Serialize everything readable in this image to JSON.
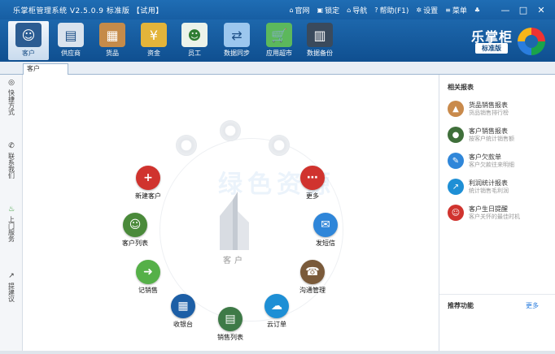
{
  "titlebar": {
    "app_title": "乐掌柜管理系统 V2.5.0.9 标准版 【试用】",
    "links": [
      {
        "icon": "home-icon",
        "glyph": "⌂",
        "label": "官网"
      },
      {
        "icon": "lock-icon",
        "glyph": "▣",
        "label": "锁定"
      },
      {
        "icon": "home-icon",
        "glyph": "⌂",
        "label": "导航"
      },
      {
        "icon": "help-icon",
        "glyph": "?",
        "label": "帮助(F1)"
      },
      {
        "icon": "gear-icon",
        "glyph": "✲",
        "label": "设置"
      },
      {
        "icon": "menu-icon",
        "glyph": "≡",
        "label": "菜单"
      },
      {
        "icon": "shirt-icon",
        "glyph": "♣",
        "label": ""
      }
    ],
    "window_buttons": [
      "—",
      "□",
      "✕"
    ]
  },
  "toolbar": {
    "items": [
      {
        "name": "toolbar-customers",
        "label": "客户",
        "icon": "customer-icon",
        "glyph": "☺",
        "active": true
      },
      {
        "name": "toolbar-suppliers",
        "label": "供应商",
        "icon": "supplier-icon",
        "glyph": "▤",
        "active": false
      },
      {
        "name": "toolbar-goods",
        "label": "货品",
        "icon": "goods-icon",
        "glyph": "▦",
        "active": false
      },
      {
        "name": "toolbar-funds",
        "label": "资金",
        "icon": "money-bag-icon",
        "glyph": "¥",
        "active": false
      },
      {
        "name": "toolbar-employees",
        "label": "员工",
        "icon": "employee-icon",
        "glyph": "☻",
        "active": false
      },
      {
        "name": "toolbar-data-sync",
        "label": "数据同步",
        "icon": "sync-icon",
        "glyph": "⇄",
        "active": false
      },
      {
        "name": "toolbar-app-market",
        "label": "应用超市",
        "icon": "cart-icon",
        "glyph": "🛒",
        "active": false
      },
      {
        "name": "toolbar-data-backup",
        "label": "数据备份",
        "icon": "backup-icon",
        "glyph": "▥",
        "active": false
      }
    ],
    "brand_name": "乐掌柜",
    "brand_edition": "标准版"
  },
  "tabs": [
    {
      "label": "客户"
    }
  ],
  "leftbar": [
    {
      "icon": "refresh-icon",
      "glyph": "◎",
      "label": "快捷方式"
    },
    {
      "icon": "phone-icon",
      "glyph": "✆",
      "label": "联系我们"
    },
    {
      "icon": "bike-icon",
      "glyph": "♨",
      "label": "上门服务"
    },
    {
      "icon": "trend-icon",
      "glyph": "↗",
      "label": "提建议"
    }
  ],
  "center": {
    "label": "客户",
    "watermark": "绿色资源"
  },
  "nodes": [
    {
      "key": "new_customer",
      "label": "新建客户",
      "icon": "add-user-icon",
      "glyph": "+",
      "color": "#d0332e"
    },
    {
      "key": "customer_list",
      "label": "客户列表",
      "icon": "people-icon",
      "glyph": "☺",
      "color": "#4a8a3a"
    },
    {
      "key": "sales_record",
      "label": "记销售",
      "icon": "sales-record-icon",
      "glyph": "➜",
      "color": "#55b048"
    },
    {
      "key": "cashier",
      "label": "收银台",
      "icon": "calculator-icon",
      "glyph": "▦",
      "color": "#1d5fa6"
    },
    {
      "key": "sales_list",
      "label": "销售列表",
      "icon": "sales-list-icon",
      "glyph": "▤",
      "color": "#3e7a47"
    },
    {
      "key": "cloud_order",
      "label": "云订单",
      "icon": "cloud-order-icon",
      "glyph": "☁",
      "color": "#1e8fd5"
    },
    {
      "key": "communication",
      "label": "沟通管理",
      "icon": "headset-icon",
      "glyph": "☎",
      "color": "#7a5a3a"
    },
    {
      "key": "send_sms",
      "label": "发短信",
      "icon": "envelope-icon",
      "glyph": "✉",
      "color": "#2f86d9"
    },
    {
      "key": "more",
      "label": "更多",
      "icon": "more-icon",
      "glyph": "⋯",
      "color": "#d0332e"
    }
  ],
  "related_reports": {
    "title": "相关报表",
    "items": [
      {
        "title": "货品销售报表",
        "desc": "货品销售排行榜",
        "icon": "goods-report-icon",
        "glyph": "▲",
        "color": "#c98a4b"
      },
      {
        "title": "客户销售报表",
        "desc": "按客户统计销售额",
        "icon": "customer-report-icon",
        "glyph": "●",
        "color": "#3f6f3a"
      },
      {
        "title": "客户欠款单",
        "desc": "客户欠款往来明细",
        "icon": "debt-report-icon",
        "glyph": "✎",
        "color": "#2f86d9"
      },
      {
        "title": "利润统计报表",
        "desc": "统计销售毛利润",
        "icon": "profit-report-icon",
        "glyph": "↗",
        "color": "#1e8fd5"
      },
      {
        "title": "客户生日提醒",
        "desc": "客户关怀的最佳时机",
        "icon": "birthday-icon",
        "glyph": "☺",
        "color": "#d0332e"
      }
    ]
  },
  "recommended": {
    "title": "推荐功能",
    "more_label": "更多"
  }
}
